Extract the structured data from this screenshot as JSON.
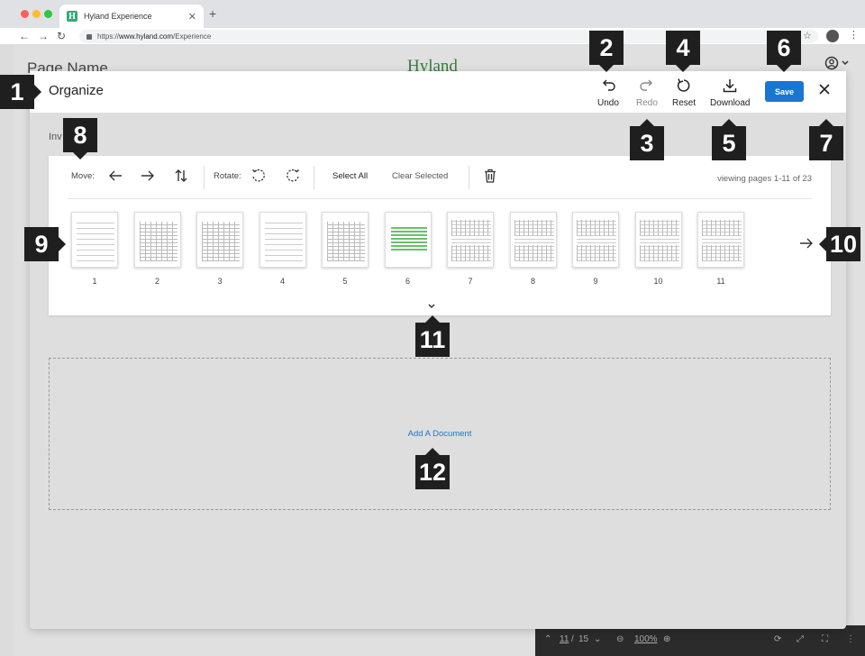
{
  "browser": {
    "tab_title": "Hyland Experience",
    "tab_favicon": "H",
    "url_prefix": "https://",
    "url_domain": "www.hyland.com",
    "url_path": "/Experience"
  },
  "page": {
    "name": "Page Name",
    "brand": "Hyland"
  },
  "viewer": {
    "page_current": "11",
    "page_total": "15",
    "zoom": "100%"
  },
  "modal": {
    "title": "Organize",
    "actions": {
      "undo": "Undo",
      "redo": "Redo",
      "reset": "Reset",
      "download": "Download",
      "save": "Save"
    },
    "document_label": "Inv",
    "toolbar": {
      "move_label": "Move:",
      "rotate_label": "Rotate:",
      "select_all": "Select All",
      "clear_selected": "Clear Selected",
      "viewing": "viewing pages  1-11 of 23"
    },
    "pages": [
      "1",
      "2",
      "3",
      "4",
      "5",
      "6",
      "7",
      "8",
      "9",
      "10",
      "11"
    ],
    "add_document": "Add A Document"
  },
  "callouts": [
    "1",
    "2",
    "3",
    "4",
    "5",
    "6",
    "7",
    "8",
    "9",
    "10",
    "11",
    "12"
  ],
  "colors": {
    "accent": "#1976d2",
    "callout": "#1f1f1f",
    "brand": "#3b7a3b"
  }
}
